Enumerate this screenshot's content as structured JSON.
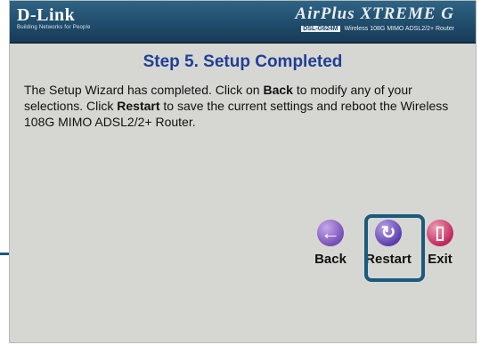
{
  "header": {
    "brand": "D-Link",
    "tagline": "Building Networks for People",
    "product_logo": "AirPlus XTREME G",
    "model_badge": "DSL-G624M",
    "model_desc": "Wireless 108G MIMO ADSL2/2+ Router"
  },
  "main": {
    "title": "Step 5. Setup Completed",
    "desc": {
      "part1": "The Setup Wizard has completed. Click on ",
      "back_word": "Back",
      "part2": " to modify any of your selections. Click ",
      "restart_word": "Restart",
      "part3": " to save the current settings and reboot the Wireless 108G MIMO ADSL2/2+ Router."
    }
  },
  "nav": {
    "back": {
      "label": "Back",
      "icon": "arrow-left-icon",
      "glyph": "←",
      "color": "#7a4fb8"
    },
    "restart": {
      "label": "Restart",
      "icon": "restart-icon",
      "glyph": "↻",
      "color": "#5c3fae"
    },
    "exit": {
      "label": "Exit",
      "icon": "door-exit-icon",
      "glyph": "▯",
      "color": "#c02a5c"
    }
  },
  "colors": {
    "header": "#1f4a69",
    "title": "#1f3f96",
    "panel": "#d6d6d3",
    "callout": "#1b5a7d"
  }
}
